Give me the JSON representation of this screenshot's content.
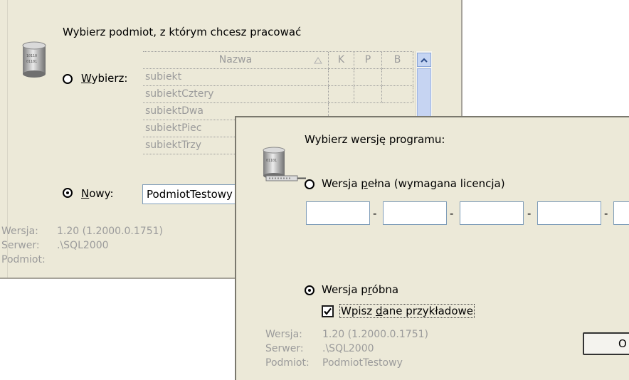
{
  "back_dialog": {
    "heading": "Wybierz podmiot, z którym chcesz pracować",
    "option_existing": {
      "underline": "W",
      "rest": "ybierz:"
    },
    "grid": {
      "columns": [
        "Nazwa",
        "K",
        "P",
        "B"
      ],
      "rows": [
        "subiekt",
        "subiektCztery",
        "subiektDwa",
        "subiektPiec",
        "subiektTrzy"
      ]
    },
    "option_new": {
      "underline": "N",
      "rest": "owy:"
    },
    "new_name_value": "PodmiotTestowy",
    "info": {
      "wersja_label": "Wersja:",
      "wersja_value": "1.20 (1.2000.0.1751)",
      "serwer_label": "Serwer:",
      "serwer_value": ".\\SQL2000",
      "podmiot_label": "Podmiot:",
      "podmiot_value": ""
    }
  },
  "front_dialog": {
    "heading": "Wybierz wersję programu:",
    "option_full": {
      "pre": "Wersja ",
      "underline": "p",
      "post": "ełna (wymagana licencja)"
    },
    "license_separator": "-",
    "option_trial": {
      "pre": "Wersja p",
      "underline": "r",
      "post": "óbna"
    },
    "checkbox": {
      "pre": "Wpisz ",
      "underline": "d",
      "post": "ane przykładowe",
      "checked": true
    },
    "info": {
      "wersja_label": "Wersja:",
      "wersja_value": "1.20 (1.2000.0.1751)",
      "serwer_label": "Serwer:",
      "serwer_value": ".\\SQL2000",
      "podmiot_label": "Podmiot:",
      "podmiot_value": "PodmiotTestowy"
    },
    "ok_label": "O"
  },
  "icons": [
    "database-icon",
    "database-network-icon",
    "sort-ascending-icon",
    "scroll-up-icon",
    "checkmark-icon"
  ]
}
